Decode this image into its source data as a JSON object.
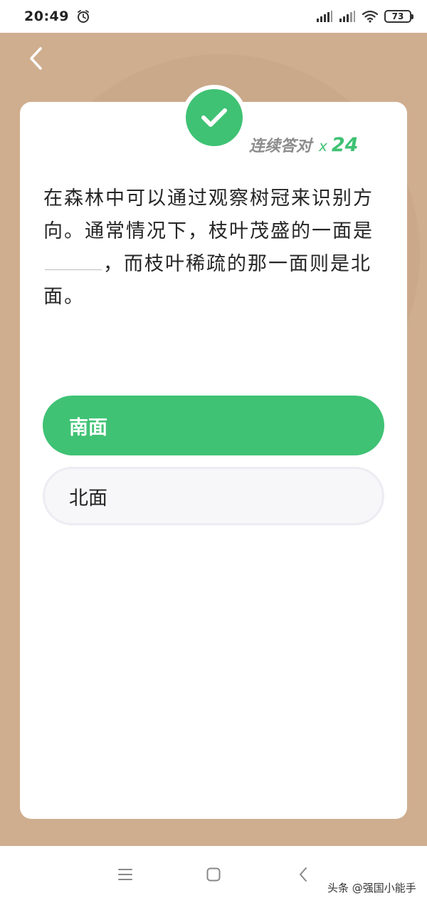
{
  "status_bar": {
    "time": "20:49",
    "battery": "73",
    "icons": [
      "alarm-icon",
      "signal-icon",
      "signal-icon",
      "wifi-icon",
      "battery-icon"
    ]
  },
  "header": {
    "back_icon": "chevron-left-icon"
  },
  "card": {
    "badge_icon": "check-icon",
    "streak_label": "连续答对",
    "streak_x": "x",
    "streak_count": "24",
    "question_part1": "在森林中可以通过观察树冠来识别方向。通常情况下，枝叶茂盛的一面是",
    "question_part2": "，而枝叶稀疏的那一面则是北面。",
    "options": [
      {
        "label": "南面",
        "selected": true
      },
      {
        "label": "北面",
        "selected": false
      }
    ]
  },
  "nav_bar": {
    "icons": [
      "menu-icon",
      "home-icon",
      "back-icon"
    ],
    "watermark": "头条 @强国小能手"
  },
  "colors": {
    "accent": "#3fc274",
    "background": "#cfae8f",
    "card": "#ffffff"
  }
}
